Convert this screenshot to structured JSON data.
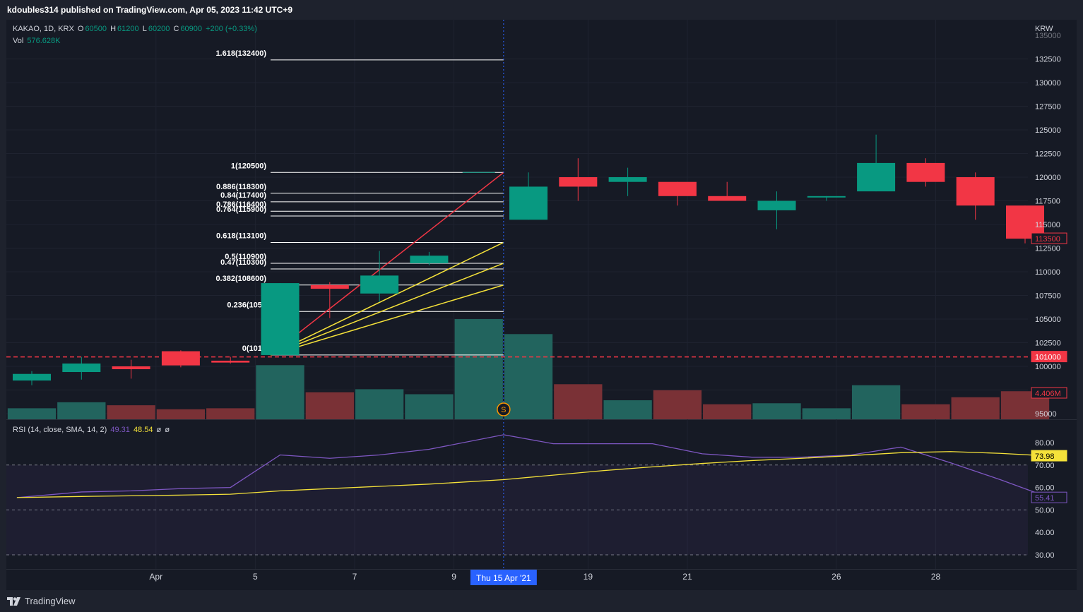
{
  "header": {
    "published_line": "kdoubles314 published on TradingView.com, Apr 05, 2023 11:42 UTC+9"
  },
  "legend": {
    "symbol": "KAKAO, 1D, KRX",
    "open_label": "O",
    "open": "60500",
    "high_label": "H",
    "high": "61200",
    "low_label": "L",
    "low": "60200",
    "close_label": "C",
    "close": "60900",
    "change": "+200 (+0.33%)",
    "vol_label": "Vol",
    "vol": "576.628K"
  },
  "rsi_legend": {
    "label": "RSI (14, close, SMA, 14, 2)",
    "rsi_value": "49.31",
    "ma_value": "48.54",
    "extra1": "ø",
    "extra2": "ø"
  },
  "footer": {
    "brand": "TradingView"
  },
  "colors": {
    "up": "#089981",
    "down": "#f23645",
    "up_vol": "#22645e",
    "down_vol": "#7a3136",
    "rsi": "#7e57c2",
    "rsi_ma": "#f5e23a",
    "fib_line": "#ffffff",
    "fan_red": "#f23645",
    "fan_yellow": "#f5e23a",
    "cursor": "#2962ff"
  },
  "chart_data": {
    "type": "candlestick",
    "currency": "KRW",
    "price_axis": {
      "ylim": [
        94000,
        136000
      ],
      "ticks": [
        95000,
        97500,
        100000,
        102500,
        105000,
        107500,
        110000,
        112500,
        115000,
        117500,
        120000,
        122500,
        125000,
        127500,
        130000,
        132500
      ],
      "partial_top_tick": "135000"
    },
    "x_axis": {
      "ticks": [
        {
          "index": 2.5,
          "label": "Apr"
        },
        {
          "index": 4.5,
          "label": "5"
        },
        {
          "index": 6.5,
          "label": "7"
        },
        {
          "index": 8.5,
          "label": "9"
        },
        {
          "index": 11.2,
          "label": "19"
        },
        {
          "index": 13.2,
          "label": "21"
        },
        {
          "index": 16.2,
          "label": "26"
        },
        {
          "index": 18.2,
          "label": "28"
        }
      ],
      "cursor_index": 9.5,
      "cursor_label": "Thu 15 Apr '21"
    },
    "candles": [
      {
        "o": 98500,
        "h": 99500,
        "l": 98000,
        "c": 99200
      },
      {
        "o": 99400,
        "h": 101000,
        "l": 98600,
        "c": 100300
      },
      {
        "o": 100000,
        "h": 100700,
        "l": 98700,
        "c": 99700
      },
      {
        "o": 101600,
        "h": 101700,
        "l": 99900,
        "c": 100100
      },
      {
        "o": 100600,
        "h": 101000,
        "l": 100300,
        "c": 100400
      },
      {
        "o": 101200,
        "h": 108800,
        "l": 101200,
        "c": 108800
      },
      {
        "o": 108600,
        "h": 108900,
        "l": 105100,
        "c": 108200
      },
      {
        "o": 107700,
        "h": 112200,
        "l": 106800,
        "c": 109600
      },
      {
        "o": 110900,
        "h": 112100,
        "l": 110700,
        "c": 111700
      },
      {
        "o": 120500,
        "h": 120500,
        "l": 120500,
        "c": 120500
      },
      {
        "o": 115500,
        "h": 120500,
        "l": 115500,
        "c": 119000
      },
      {
        "o": 120000,
        "h": 122000,
        "l": 117500,
        "c": 119000
      },
      {
        "o": 119500,
        "h": 121000,
        "l": 118000,
        "c": 120000
      },
      {
        "o": 119500,
        "h": 119500,
        "l": 117000,
        "c": 118000
      },
      {
        "o": 118000,
        "h": 119500,
        "l": 117500,
        "c": 117500
      },
      {
        "o": 116500,
        "h": 118500,
        "l": 114500,
        "c": 117500
      },
      {
        "o": 118000,
        "h": 118000,
        "l": 117500,
        "c": 118000
      },
      {
        "o": 118500,
        "h": 124500,
        "l": 118500,
        "c": 121500
      },
      {
        "o": 121500,
        "h": 122000,
        "l": 119000,
        "c": 119500
      },
      {
        "o": 120000,
        "h": 120500,
        "l": 115500,
        "c": 117000
      },
      {
        "o": 117000,
        "h": 117000,
        "l": 113000,
        "c": 113500
      }
    ],
    "volume_ratio": [
      0.11,
      0.17,
      0.14,
      0.1,
      0.11,
      0.54,
      0.27,
      0.3,
      0.25,
      1.0,
      0.85,
      0.35,
      0.19,
      0.29,
      0.15,
      0.16,
      0.11,
      0.34,
      0.15,
      0.22,
      0.28
    ],
    "volume_up": [
      true,
      true,
      false,
      false,
      false,
      true,
      false,
      true,
      true,
      true,
      true,
      false,
      true,
      false,
      false,
      true,
      true,
      true,
      false,
      false,
      false
    ],
    "volume_last_label": "4.406M",
    "current_price_label": "113500",
    "red_dashed_line": 101000,
    "red_dashed_label": "101000",
    "fibonacci": {
      "start_index": 5.5,
      "end_index": 9.5,
      "levels": [
        {
          "ratio": "1.618",
          "price": 132400,
          "label": "1.618(132400)"
        },
        {
          "ratio": "1",
          "price": 120500,
          "label": "1(120500)"
        },
        {
          "ratio": "0.886",
          "price": 118300,
          "label": "0.886(118300)"
        },
        {
          "ratio": "0.84",
          "price": 117400,
          "label": "0.84(117400)"
        },
        {
          "ratio": "0.786",
          "price": 116400,
          "label": "0.786(116400)"
        },
        {
          "ratio": "0.764",
          "price": 115900,
          "label": "0.764(115900)"
        },
        {
          "ratio": "0.618",
          "price": 113100,
          "label": "0.618(113100)"
        },
        {
          "ratio": "0.5",
          "price": 110900,
          "label": "0.5(110900)"
        },
        {
          "ratio": "0.47",
          "price": 110300,
          "label": "0.47(110300)"
        },
        {
          "ratio": "0.382",
          "price": 108600,
          "label": "0.382(108600)"
        },
        {
          "ratio": "0.236",
          "price": 105800,
          "label": "0.236(1058"
        },
        {
          "ratio": "0",
          "price": 101200,
          "label": "0(1012"
        }
      ]
    },
    "rsi": {
      "ylim": [
        28,
        86
      ],
      "ticks": [
        30,
        40,
        50,
        60,
        70,
        80
      ],
      "tick_labels": [
        "30.00",
        "40.00",
        "50.00",
        "60.00",
        "70.00",
        "80.00"
      ],
      "band_upper": 70,
      "band_lower": 30,
      "mid": 50,
      "x": [
        -0.3,
        1,
        2,
        3,
        4,
        5,
        6,
        7,
        8,
        9.5,
        10.5,
        11.5,
        12.5,
        13.5,
        14.5,
        15.5,
        16.5,
        17.5,
        18.5,
        19.5,
        20.5
      ],
      "values": [
        55.5,
        58,
        58.5,
        59.5,
        60,
        74.5,
        73,
        74.5,
        77,
        83.5,
        79.5,
        79.5,
        79.5,
        75,
        73.5,
        73.5,
        74.5,
        78,
        71,
        63.5,
        55.4
      ],
      "ma_values": [
        55.5,
        56,
        56.3,
        56.6,
        57,
        58.5,
        59.5,
        60.5,
        61.5,
        63.5,
        65.5,
        67.5,
        69.2,
        70.7,
        72,
        73,
        74.2,
        75.5,
        76,
        75.2,
        74
      ],
      "last_rsi_label": "55.41",
      "last_ma_label": "73.98"
    }
  }
}
